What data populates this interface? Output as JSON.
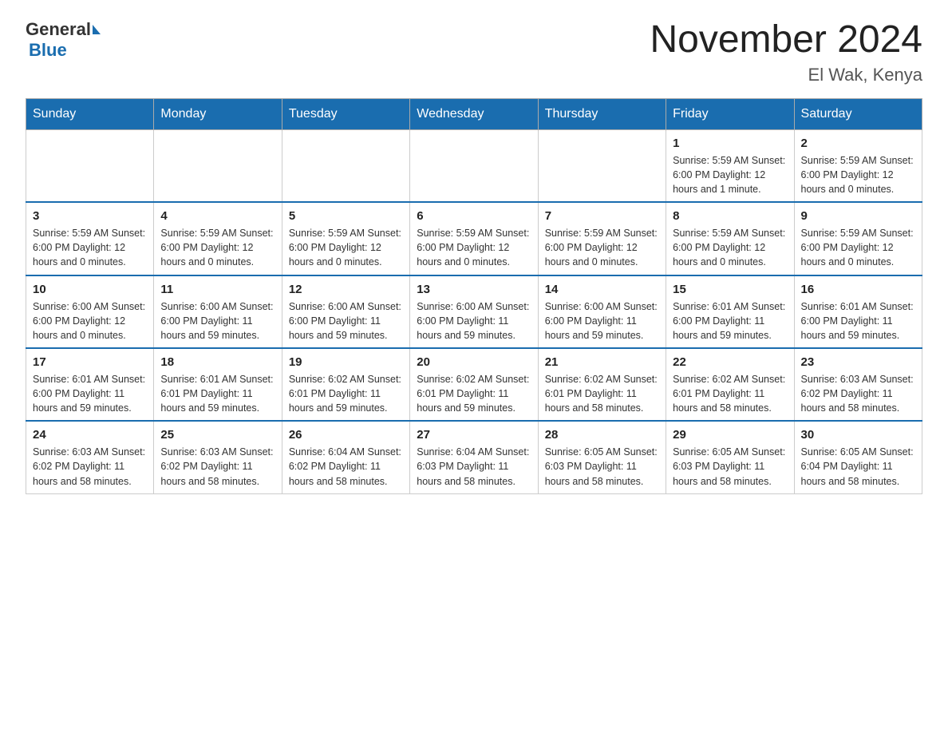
{
  "header": {
    "logo_general": "General",
    "logo_blue": "Blue",
    "title": "November 2024",
    "subtitle": "El Wak, Kenya"
  },
  "days_of_week": [
    "Sunday",
    "Monday",
    "Tuesday",
    "Wednesday",
    "Thursday",
    "Friday",
    "Saturday"
  ],
  "weeks": [
    [
      {
        "day": "",
        "info": ""
      },
      {
        "day": "",
        "info": ""
      },
      {
        "day": "",
        "info": ""
      },
      {
        "day": "",
        "info": ""
      },
      {
        "day": "",
        "info": ""
      },
      {
        "day": "1",
        "info": "Sunrise: 5:59 AM\nSunset: 6:00 PM\nDaylight: 12 hours and 1 minute."
      },
      {
        "day": "2",
        "info": "Sunrise: 5:59 AM\nSunset: 6:00 PM\nDaylight: 12 hours and 0 minutes."
      }
    ],
    [
      {
        "day": "3",
        "info": "Sunrise: 5:59 AM\nSunset: 6:00 PM\nDaylight: 12 hours and 0 minutes."
      },
      {
        "day": "4",
        "info": "Sunrise: 5:59 AM\nSunset: 6:00 PM\nDaylight: 12 hours and 0 minutes."
      },
      {
        "day": "5",
        "info": "Sunrise: 5:59 AM\nSunset: 6:00 PM\nDaylight: 12 hours and 0 minutes."
      },
      {
        "day": "6",
        "info": "Sunrise: 5:59 AM\nSunset: 6:00 PM\nDaylight: 12 hours and 0 minutes."
      },
      {
        "day": "7",
        "info": "Sunrise: 5:59 AM\nSunset: 6:00 PM\nDaylight: 12 hours and 0 minutes."
      },
      {
        "day": "8",
        "info": "Sunrise: 5:59 AM\nSunset: 6:00 PM\nDaylight: 12 hours and 0 minutes."
      },
      {
        "day": "9",
        "info": "Sunrise: 5:59 AM\nSunset: 6:00 PM\nDaylight: 12 hours and 0 minutes."
      }
    ],
    [
      {
        "day": "10",
        "info": "Sunrise: 6:00 AM\nSunset: 6:00 PM\nDaylight: 12 hours and 0 minutes."
      },
      {
        "day": "11",
        "info": "Sunrise: 6:00 AM\nSunset: 6:00 PM\nDaylight: 11 hours and 59 minutes."
      },
      {
        "day": "12",
        "info": "Sunrise: 6:00 AM\nSunset: 6:00 PM\nDaylight: 11 hours and 59 minutes."
      },
      {
        "day": "13",
        "info": "Sunrise: 6:00 AM\nSunset: 6:00 PM\nDaylight: 11 hours and 59 minutes."
      },
      {
        "day": "14",
        "info": "Sunrise: 6:00 AM\nSunset: 6:00 PM\nDaylight: 11 hours and 59 minutes."
      },
      {
        "day": "15",
        "info": "Sunrise: 6:01 AM\nSunset: 6:00 PM\nDaylight: 11 hours and 59 minutes."
      },
      {
        "day": "16",
        "info": "Sunrise: 6:01 AM\nSunset: 6:00 PM\nDaylight: 11 hours and 59 minutes."
      }
    ],
    [
      {
        "day": "17",
        "info": "Sunrise: 6:01 AM\nSunset: 6:00 PM\nDaylight: 11 hours and 59 minutes."
      },
      {
        "day": "18",
        "info": "Sunrise: 6:01 AM\nSunset: 6:01 PM\nDaylight: 11 hours and 59 minutes."
      },
      {
        "day": "19",
        "info": "Sunrise: 6:02 AM\nSunset: 6:01 PM\nDaylight: 11 hours and 59 minutes."
      },
      {
        "day": "20",
        "info": "Sunrise: 6:02 AM\nSunset: 6:01 PM\nDaylight: 11 hours and 59 minutes."
      },
      {
        "day": "21",
        "info": "Sunrise: 6:02 AM\nSunset: 6:01 PM\nDaylight: 11 hours and 58 minutes."
      },
      {
        "day": "22",
        "info": "Sunrise: 6:02 AM\nSunset: 6:01 PM\nDaylight: 11 hours and 58 minutes."
      },
      {
        "day": "23",
        "info": "Sunrise: 6:03 AM\nSunset: 6:02 PM\nDaylight: 11 hours and 58 minutes."
      }
    ],
    [
      {
        "day": "24",
        "info": "Sunrise: 6:03 AM\nSunset: 6:02 PM\nDaylight: 11 hours and 58 minutes."
      },
      {
        "day": "25",
        "info": "Sunrise: 6:03 AM\nSunset: 6:02 PM\nDaylight: 11 hours and 58 minutes."
      },
      {
        "day": "26",
        "info": "Sunrise: 6:04 AM\nSunset: 6:02 PM\nDaylight: 11 hours and 58 minutes."
      },
      {
        "day": "27",
        "info": "Sunrise: 6:04 AM\nSunset: 6:03 PM\nDaylight: 11 hours and 58 minutes."
      },
      {
        "day": "28",
        "info": "Sunrise: 6:05 AM\nSunset: 6:03 PM\nDaylight: 11 hours and 58 minutes."
      },
      {
        "day": "29",
        "info": "Sunrise: 6:05 AM\nSunset: 6:03 PM\nDaylight: 11 hours and 58 minutes."
      },
      {
        "day": "30",
        "info": "Sunrise: 6:05 AM\nSunset: 6:04 PM\nDaylight: 11 hours and 58 minutes."
      }
    ]
  ]
}
